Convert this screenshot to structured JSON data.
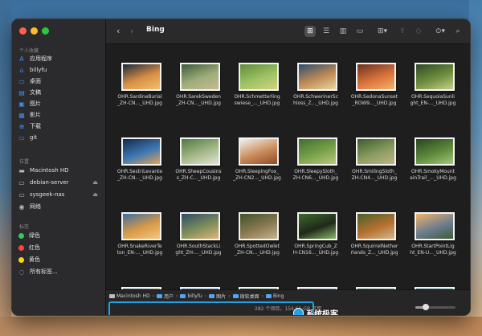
{
  "window": {
    "title": "Bing"
  },
  "sidebar": {
    "sections": [
      {
        "label": "个人收藏",
        "items": [
          {
            "label": "应用程序",
            "icon": "applications-icon"
          },
          {
            "label": "billyfu",
            "icon": "home-icon"
          },
          {
            "label": "桌面",
            "icon": "desktop-icon"
          },
          {
            "label": "文稿",
            "icon": "document-icon"
          },
          {
            "label": "图片",
            "icon": "pictures-icon"
          },
          {
            "label": "影片",
            "icon": "movies-icon"
          },
          {
            "label": "下载",
            "icon": "downloads-icon"
          },
          {
            "label": "git",
            "icon": "folder-icon"
          }
        ]
      },
      {
        "label": "位置",
        "items": [
          {
            "label": "Macintosh HD",
            "icon": "hard-disk-icon"
          },
          {
            "label": "debian-server",
            "icon": "server-icon",
            "eject": true
          },
          {
            "label": "sysgeek-nas",
            "icon": "server-icon",
            "eject": true
          },
          {
            "label": "网络",
            "icon": "network-icon"
          }
        ]
      },
      {
        "label": "标签",
        "items": [
          {
            "label": "绿色",
            "color": "#34c759"
          },
          {
            "label": "红色",
            "color": "#ff453a"
          },
          {
            "label": "黄色",
            "color": "#ffd60a"
          },
          {
            "label": "所有标签...",
            "icon": "all-tags-icon"
          }
        ]
      }
    ]
  },
  "files": [
    {
      "name_line1": "OHR.SardineBurial",
      "name_line2": "_ZH-CN..._UHD.jpg",
      "colors": [
        "#1b2a3d",
        "#d98f45",
        "#f1c06b"
      ]
    },
    {
      "name_line1": "OHR.SarekSweden",
      "name_line2": "_ZH-CN..._UHD.jpg",
      "colors": [
        "#3f5a38",
        "#9fae7c",
        "#c7b98c"
      ]
    },
    {
      "name_line1": "OHR.Schmetterling",
      "name_line2": "swiese_..._UHD.jpg",
      "colors": [
        "#5f8d3a",
        "#9fc265",
        "#d2d27a"
      ]
    },
    {
      "name_line1": "OHR.SchwerinerSc",
      "name_line2": "hloss_Z..._UHD.jpg",
      "colors": [
        "#2c4f6d",
        "#c08b56",
        "#e8d6a3"
      ]
    },
    {
      "name_line1": "OHR.SedonaSunset",
      "name_line2": "_ROW9..._UHD.jpg",
      "colors": [
        "#6a3122",
        "#d9733c",
        "#f3b36a"
      ]
    },
    {
      "name_line1": "OHR.SequoiaSunli",
      "name_line2": "ght_EN-..._UHD.jpg",
      "colors": [
        "#2f4a25",
        "#6f8f3f",
        "#c4d08a"
      ]
    },
    {
      "name_line1": "OHR.SestriLevante",
      "name_line2": "_ZH-CN..._UHD.jpg",
      "colors": [
        "#142a4a",
        "#3e78b5",
        "#e2a356"
      ]
    },
    {
      "name_line1": "OHR.SheepCousins",
      "name_line2": "s_ZH-C..._UHD.jpg",
      "colors": [
        "#4f7a3e",
        "#a5b98a",
        "#e1e3d8"
      ]
    },
    {
      "name_line1": "OHR.SleepingFox_",
      "name_line2": "_ZH-CN2..._UHD.jpg",
      "colors": [
        "#f1f1f1",
        "#c98b59",
        "#8f4b2a"
      ]
    },
    {
      "name_line1": "OHR.SleepySloth_",
      "name_line2": "ZH-CN6..._UHD.jpg",
      "colors": [
        "#3f6f2d",
        "#7aa24b",
        "#b9c87e"
      ]
    },
    {
      "name_line1": "OHR.SmilingSloth_",
      "name_line2": "ZH-CN4..._UHD.jpg",
      "colors": [
        "#3c5d2f",
        "#8a9c60",
        "#c0b48a"
      ]
    },
    {
      "name_line1": "OHR.SmokyMount",
      "name_line2": "ainTrail_..._UHD.jpg",
      "colors": [
        "#27451f",
        "#5e8a3c",
        "#a7c67c"
      ]
    },
    {
      "name_line1": "OHR.SnakeRiverTe",
      "name_line2": "ton_EN-..._UHD.jpg",
      "colors": [
        "#3a6fa1",
        "#d99a47",
        "#f2c87e"
      ]
    },
    {
      "name_line1": "OHR.SouthStackLi",
      "name_line2": "ght_ZH-..._UHD.jpg",
      "colors": [
        "#2d4a6a",
        "#7f8f5a",
        "#e0b47a"
      ]
    },
    {
      "name_line1": "OHR.SpottedOwlet",
      "name_line2": "_ZH-CN..._UHD.jpg",
      "colors": [
        "#3e5229",
        "#8a7a52",
        "#c5b38c"
      ]
    },
    {
      "name_line1": "OHR.SpringCub_Z",
      "name_line2": "H-CN16..._UHD.jpg",
      "colors": [
        "#3d6a2a",
        "#1f2a1a",
        "#8fb56a"
      ]
    },
    {
      "name_line1": "OHR.SquirrelNether",
      "name_line2": "rlands_Z..._UHD.jpg",
      "colors": [
        "#4a5f2a",
        "#b5702f",
        "#d7b88b"
      ]
    },
    {
      "name_line1": "OHR.StartPointLig",
      "name_line2": "ht_EN-U..._UHD.jpg",
      "colors": [
        "#f0b36a",
        "#6c7d8e",
        "#3d5a3a"
      ]
    },
    {
      "name_line1": "",
      "name_line2": "",
      "colors": [
        "#3a5a7a",
        "#b0a38a",
        "#e0c6a0"
      ]
    },
    {
      "name_line1": "",
      "name_line2": "",
      "colors": [
        "#406a86",
        "#8fa3b3",
        "#d7d1c2"
      ]
    },
    {
      "name_line1": "",
      "name_line2": "",
      "colors": [
        "#2e4f3a",
        "#6f9262",
        "#c6c09e"
      ]
    },
    {
      "name_line1": "",
      "name_line2": "",
      "colors": [
        "#5a6e7a",
        "#9fb4c4",
        "#e2dbc8"
      ]
    },
    {
      "name_line1": "",
      "name_line2": "",
      "colors": [
        "#3b6d5f",
        "#7fa39a",
        "#d4d8cc"
      ]
    },
    {
      "name_line1": "",
      "name_line2": "",
      "colors": [
        "#1f5e73",
        "#5fa0b2",
        "#c9e0e3"
      ]
    }
  ],
  "pathbar": {
    "crumbs": [
      {
        "label": "Macintosh HD",
        "type": "disk"
      },
      {
        "label": "用户",
        "type": "folder"
      },
      {
        "label": "billyfu",
        "type": "folder"
      },
      {
        "label": "图片",
        "type": "folder"
      },
      {
        "label": "微软桌面",
        "type": "folder"
      },
      {
        "label": "Bing",
        "type": "folder"
      }
    ]
  },
  "status": {
    "text": "282 个项目，154.61 GB 可用"
  },
  "watermark": {
    "text": "系统极客"
  },
  "colors": {
    "highlight": "#1fa3e6",
    "folder": "#4ea6f4",
    "sidebar_icon": "#3d8bf5"
  }
}
